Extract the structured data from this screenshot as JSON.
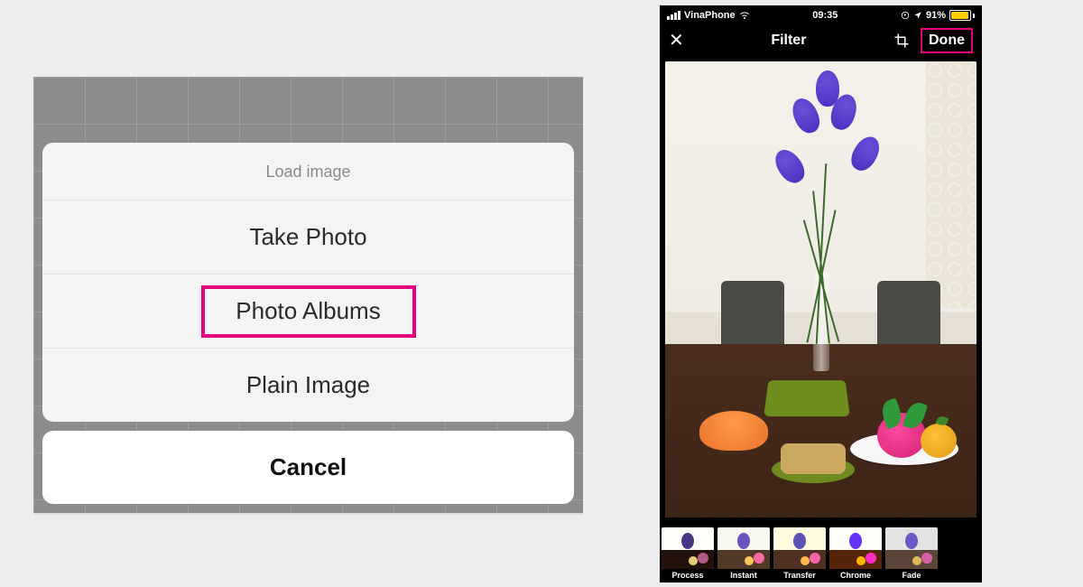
{
  "highlight_color": "#e6007e",
  "action_sheet": {
    "title": "Load image",
    "options": [
      "Take Photo",
      "Photo Albums",
      "Plain Image"
    ],
    "highlighted_index": 1,
    "cancel": "Cancel"
  },
  "phone": {
    "status": {
      "carrier": "VinaPhone",
      "time": "09:35",
      "battery_pct": "91%"
    },
    "nav": {
      "title": "Filter",
      "done": "Done",
      "done_highlighted": true
    },
    "filters": [
      "Process",
      "Instant",
      "Transfer",
      "Chrome",
      "Fade"
    ]
  }
}
